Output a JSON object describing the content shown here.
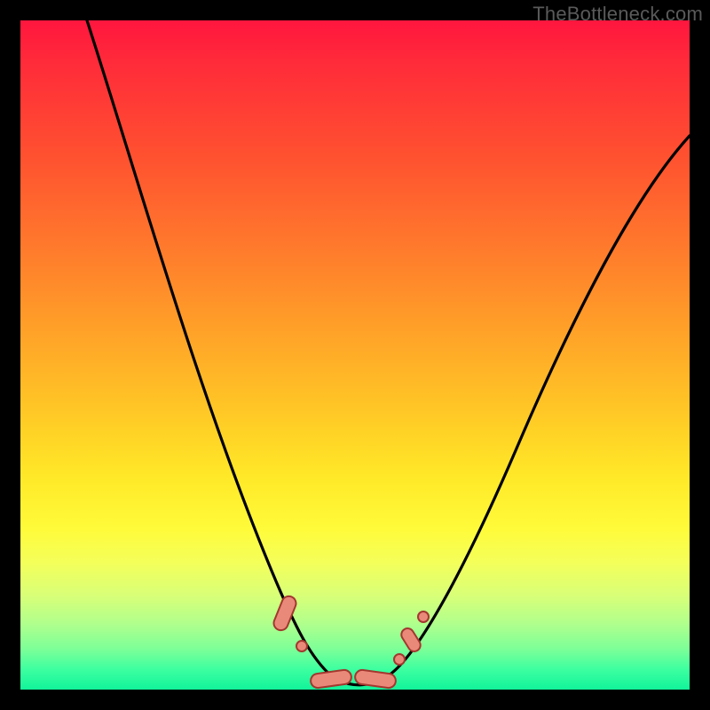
{
  "watermark": "TheBottleneck.com",
  "colors": {
    "background_frame": "#000000",
    "gradient_top": "#ff163e",
    "gradient_mid": "#ffe827",
    "gradient_bottom": "#12f39a",
    "curve_stroke": "#000000",
    "marker_fill": "#e9897a",
    "marker_stroke": "#a4372f"
  },
  "chart_data": {
    "type": "line",
    "title": "",
    "xlabel": "",
    "ylabel": "",
    "xlim": [
      0,
      100
    ],
    "ylim": [
      0,
      100
    ],
    "series": [
      {
        "name": "bottleneck-curve",
        "x": [
          10,
          14,
          18,
          22,
          26,
          30,
          34,
          38,
          41,
          43,
          45,
          47,
          49,
          51,
          53,
          55,
          58,
          62,
          66,
          70,
          76,
          82,
          88,
          94,
          100
        ],
        "y": [
          100,
          88,
          76,
          64,
          53,
          42,
          31,
          20,
          12,
          7,
          4,
          2,
          1,
          1,
          2,
          4,
          8,
          15,
          24,
          33,
          45,
          56,
          66,
          75,
          83
        ]
      }
    ],
    "markers": [
      {
        "shape": "capsule",
        "x_center": 40.5,
        "y_center": 8.0,
        "length": 5.0,
        "angle_deg": -68
      },
      {
        "shape": "dot",
        "x_center": 42.5,
        "y_center": 4.0
      },
      {
        "shape": "capsule",
        "x_center": 47.0,
        "y_center": 1.5,
        "length": 5.0,
        "angle_deg": -10
      },
      {
        "shape": "capsule",
        "x_center": 52.0,
        "y_center": 1.5,
        "length": 5.0,
        "angle_deg": 8
      },
      {
        "shape": "dot",
        "x_center": 55.5,
        "y_center": 4.5
      },
      {
        "shape": "capsule",
        "x_center": 57.5,
        "y_center": 7.5,
        "length": 3.5,
        "angle_deg": 58
      },
      {
        "shape": "dot",
        "x_center": 59.5,
        "y_center": 11.5
      }
    ]
  }
}
